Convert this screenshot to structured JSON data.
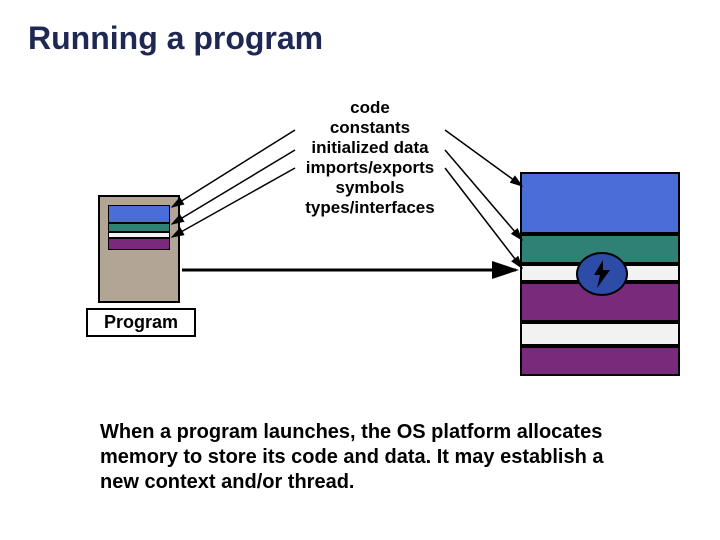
{
  "title": "Running a program",
  "code_items": {
    "l1": "code",
    "l2": "constants",
    "l3": "initialized data",
    "l4": "imports/exports",
    "l5": "symbols",
    "l6": "types/interfaces"
  },
  "program_label": "Program",
  "caption": "When a program launches, the OS platform allocates memory to store its code and data. It may establish a new context and/or thread.",
  "colors": {
    "blue": "#4a6dd8",
    "teal": "#2f8176",
    "purple": "#7a2a7a",
    "tan": "#b3a595",
    "bolt_oval": "#2d4ca8"
  }
}
